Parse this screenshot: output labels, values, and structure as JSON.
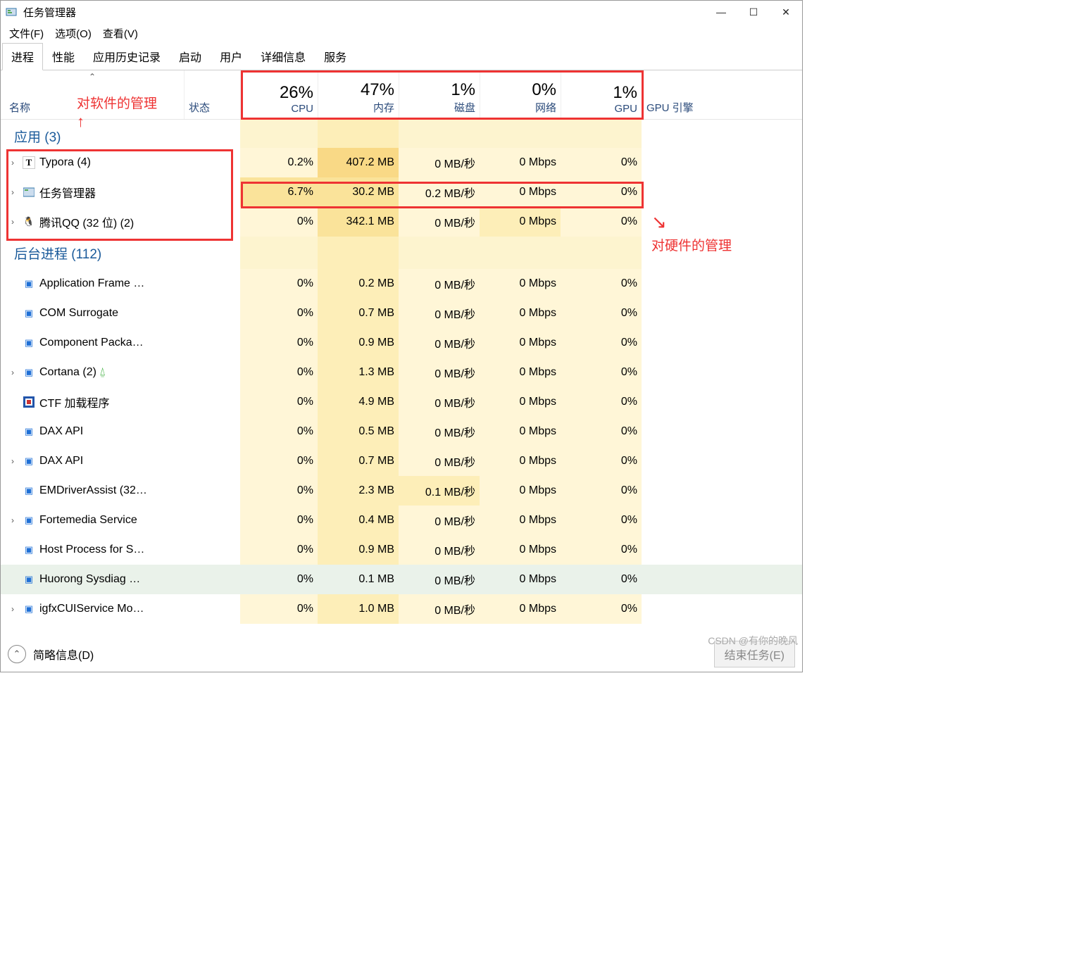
{
  "window": {
    "title": "任务管理器"
  },
  "menubar": [
    "文件(F)",
    "选项(O)",
    "查看(V)"
  ],
  "tabs": [
    "进程",
    "性能",
    "应用历史记录",
    "启动",
    "用户",
    "详细信息",
    "服务"
  ],
  "headers": {
    "name": "名称",
    "status": "状态",
    "gpu_engine": "GPU 引擎",
    "cols": [
      {
        "pct": "26%",
        "label": "CPU"
      },
      {
        "pct": "47%",
        "label": "内存"
      },
      {
        "pct": "1%",
        "label": "磁盘"
      },
      {
        "pct": "0%",
        "label": "网络"
      },
      {
        "pct": "1%",
        "label": "GPU"
      }
    ]
  },
  "groups": {
    "apps": "应用 (3)",
    "bg": "后台进程 (112)"
  },
  "apps": [
    {
      "exp": true,
      "icon": "T",
      "name": "Typora (4)",
      "cpu": "0.2%",
      "mem": "407.2 MB",
      "disk": "0 MB/秒",
      "net": "0 Mbps",
      "gpu": "0%"
    },
    {
      "exp": true,
      "icon": "tm",
      "name": "任务管理器",
      "cpu": "6.7%",
      "mem": "30.2 MB",
      "disk": "0.2 MB/秒",
      "net": "0 Mbps",
      "gpu": "0%"
    },
    {
      "exp": true,
      "icon": "qq",
      "name": "腾讯QQ (32 位) (2)",
      "cpu": "0%",
      "mem": "342.1 MB",
      "disk": "0 MB/秒",
      "net": "0 Mbps",
      "gpu": "0%"
    }
  ],
  "bg": [
    {
      "name": "Application Frame …",
      "cpu": "0%",
      "mem": "0.2 MB",
      "disk": "0 MB/秒",
      "net": "0 Mbps",
      "gpu": "0%"
    },
    {
      "name": "COM Surrogate",
      "cpu": "0%",
      "mem": "0.7 MB",
      "disk": "0 MB/秒",
      "net": "0 Mbps",
      "gpu": "0%"
    },
    {
      "name": "Component Packa…",
      "cpu": "0%",
      "mem": "0.9 MB",
      "disk": "0 MB/秒",
      "net": "0 Mbps",
      "gpu": "0%"
    },
    {
      "name": "Cortana (2)",
      "exp": true,
      "leaf": true,
      "cpu": "0%",
      "mem": "1.3 MB",
      "disk": "0 MB/秒",
      "net": "0 Mbps",
      "gpu": "0%"
    },
    {
      "name": "CTF 加载程序",
      "icon": "ctf",
      "cpu": "0%",
      "mem": "4.9 MB",
      "disk": "0 MB/秒",
      "net": "0 Mbps",
      "gpu": "0%"
    },
    {
      "name": "DAX API",
      "cpu": "0%",
      "mem": "0.5 MB",
      "disk": "0 MB/秒",
      "net": "0 Mbps",
      "gpu": "0%"
    },
    {
      "name": "DAX API",
      "exp": true,
      "cpu": "0%",
      "mem": "0.7 MB",
      "disk": "0 MB/秒",
      "net": "0 Mbps",
      "gpu": "0%"
    },
    {
      "name": "EMDriverAssist (32…",
      "cpu": "0%",
      "mem": "2.3 MB",
      "disk": "0.1 MB/秒",
      "net": "0 Mbps",
      "gpu": "0%",
      "diskHi": true
    },
    {
      "name": "Fortemedia Service",
      "exp": true,
      "cpu": "0%",
      "mem": "0.4 MB",
      "disk": "0 MB/秒",
      "net": "0 Mbps",
      "gpu": "0%"
    },
    {
      "name": "Host Process for S…",
      "cpu": "0%",
      "mem": "0.9 MB",
      "disk": "0 MB/秒",
      "net": "0 Mbps",
      "gpu": "0%"
    },
    {
      "name": "Huorong Sysdiag …",
      "sel": true,
      "cpu": "0%",
      "mem": "0.1 MB",
      "disk": "0 MB/秒",
      "net": "0 Mbps",
      "gpu": "0%"
    },
    {
      "name": "igfxCUIService Mo…",
      "exp": true,
      "cpu": "0%",
      "mem": "1.0 MB",
      "disk": "0 MB/秒",
      "net": "0 Mbps",
      "gpu": "0%"
    }
  ],
  "footer": {
    "fewer": "简略信息(D)",
    "end": "结束任务(E)"
  },
  "annot": {
    "software": "对软件的管理",
    "hardware": "对硬件的管理"
  },
  "watermark": "CSDN @有你的晚风"
}
